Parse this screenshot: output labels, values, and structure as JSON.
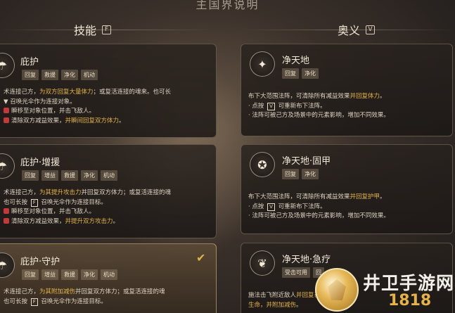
{
  "page_title": "主国界说明",
  "columns": {
    "skills": {
      "label": "技能",
      "key": "F"
    },
    "ultimate": {
      "label": "奥义",
      "key": "V"
    }
  },
  "skills": [
    {
      "title": "庇护",
      "tags": [
        "回复",
        "救援",
        "净化",
        "机动"
      ],
      "lines": [
        [
          "术连接己方，",
          {
            "hl": "为双方回复大量体力"
          },
          "；或复活连接的魂来。也可长"
        ],
        [
          "▼ 召唤光伞作为连接对象。"
        ],
        [
          {
            "badge": true
          },
          "瞬移至对象位置，并击飞敌人。"
        ],
        [
          {
            "badge": true
          },
          "清除双方减益效果，",
          {
            "hl": "并瞬间回复双方体力"
          },
          "。"
        ]
      ],
      "selected": false
    },
    {
      "title": "庇护·增援",
      "tags": [
        "回复",
        "增益",
        "救援",
        "净化",
        "机动"
      ],
      "lines": [
        [
          "术连接己方，",
          {
            "hl": "为其提升攻击力"
          },
          "并回复双方体力；或复活连接的魂"
        ],
        [
          "也可长按 ",
          {
            "kbd": "F"
          },
          " 召唤光伞作为连接目标。"
        ],
        [
          {
            "badge": true
          },
          "瞬移至对象位置，并击飞敌人。"
        ],
        [
          {
            "badge": true
          },
          "清除双方减益效果，",
          {
            "hl": "并提升双方攻击力"
          },
          "。"
        ]
      ],
      "selected": false
    },
    {
      "title": "庇护·守护",
      "tags": [
        "回复",
        "增益",
        "救援",
        "净化",
        "机动"
      ],
      "lines": [
        [
          "术连接己方，",
          {
            "hl": "为其附加减伤"
          },
          "并回复双方体力；或复活连接的魂"
        ],
        [
          "也可长按 ",
          {
            "kbd": "F"
          },
          " 召唤光伞作为连接目标。"
        ]
      ],
      "selected": true,
      "check": "✔"
    }
  ],
  "ultimates": [
    {
      "title": "净天地",
      "tags": [
        "回复",
        "净化"
      ],
      "lines": [
        [
          "布下大范围法阵，可清除所有减益效果",
          {
            "hl": "并回复体力"
          },
          "。"
        ],
        [
          "· 点按 ",
          {
            "kbd": "V"
          },
          " 可重新布下法阵。"
        ],
        [
          "· 法阵可被己方及场景中的元素影响，增加不同效果。"
        ]
      ]
    },
    {
      "title": "净天地·固甲",
      "tags": [
        "回复",
        "净化"
      ],
      "lines": [
        [
          "布下大范围法阵，可清除所有减益效果",
          {
            "hl": "并回复护甲"
          },
          "。"
        ],
        [
          "· 点按 ",
          {
            "kbd": "V"
          },
          " 可重新布下法阵。"
        ],
        [
          "· 法阵可被己方及场景中的元素影响，增加不同效果。"
        ]
      ]
    },
    {
      "title": "净天地·急疗",
      "tags": [
        "受击可用",
        "回"
      ],
      "lines": [
        [
          "施法击飞附近敌人",
          {
            "hl": "并回复己方一定生"
          }
        ],
        [
          "",
          {
            "hl": "生命，并附加减伤"
          },
          "。"
        ]
      ]
    }
  ],
  "watermark": {
    "text": "井卫手游网",
    "sub": "1818"
  },
  "icons": {
    "skill": "umbrella-icon",
    "ultimate": "lotus-icon",
    "check": "check-icon"
  }
}
